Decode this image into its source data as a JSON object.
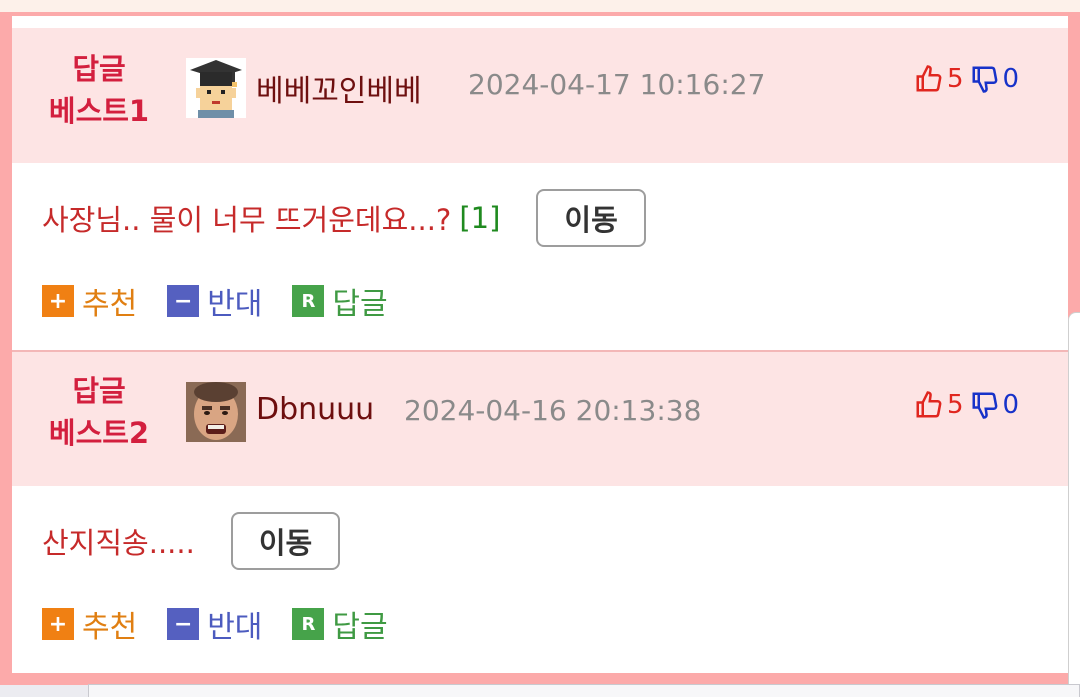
{
  "replies": [
    {
      "best_line1": "답글",
      "best_line2": "베스트1",
      "nickname": "베베꼬인베베",
      "date": "2024-04-17 10:16:27",
      "upvotes": "5",
      "downvotes": "0",
      "content": "사장님.. 물이 너무 뜨거운데요...?",
      "comment_count": "[1]",
      "move_label": "이동",
      "actions": {
        "recommend": "추천",
        "oppose": "반대",
        "reply": "답글"
      },
      "avatar_icon": "graduate-avatar-icon"
    },
    {
      "best_line1": "답글",
      "best_line2": "베스트2",
      "nickname": "Dbnuuu",
      "date": "2024-04-16 20:13:38",
      "upvotes": "5",
      "downvotes": "0",
      "content": "산지직송.....",
      "move_label": "이동",
      "actions": {
        "recommend": "추천",
        "oppose": "반대",
        "reply": "답글"
      },
      "avatar_icon": "face-photo-avatar"
    }
  ],
  "colors": {
    "frame": "#fcaaaa",
    "header_bg": "#fde4e4",
    "best_label": "#d31f3e",
    "content_text": "#c62a2a",
    "upvote": "#e0261f",
    "downvote": "#1732c9"
  }
}
